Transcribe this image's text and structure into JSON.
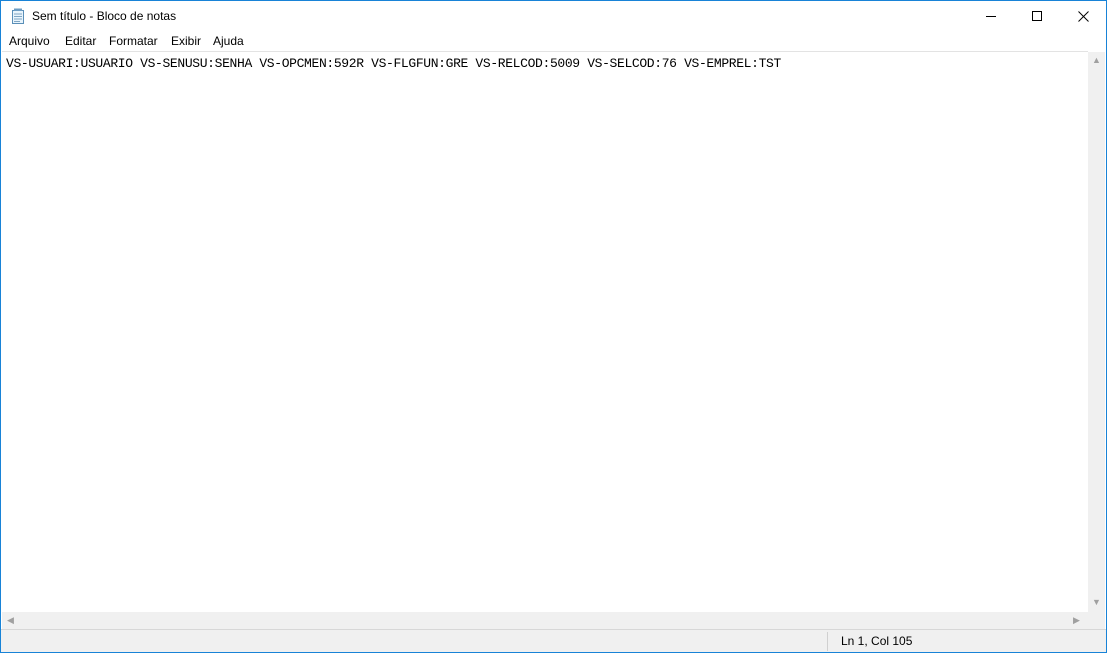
{
  "window": {
    "title": "Sem título - Bloco de notas",
    "icon": "notepad-icon",
    "controls": {
      "minimize": "minimize-icon",
      "maximize": "maximize-icon",
      "close": "close-icon"
    }
  },
  "menu": {
    "items": [
      {
        "label": "Arquivo"
      },
      {
        "label": "Editar"
      },
      {
        "label": "Formatar"
      },
      {
        "label": "Exibir"
      },
      {
        "label": "Ajuda"
      }
    ]
  },
  "editor": {
    "content": "VS-USUARI:USUARIO VS-SENUSU:SENHA VS-OPCMEN:592R VS-FLGFUN:GRE VS-RELCOD:5009 VS-SELCOD:76 VS-EMPREL:TST"
  },
  "status": {
    "position": "Ln 1, Col 105"
  },
  "colors": {
    "window_border": "#1883d7",
    "chrome_background": "#f0f0f0",
    "text": "#000000"
  }
}
